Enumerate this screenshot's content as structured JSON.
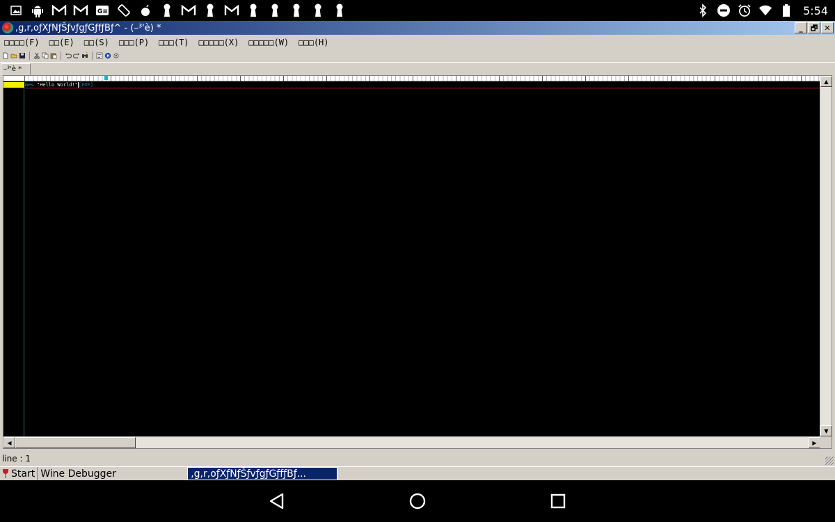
{
  "status_bar": {
    "notification_icons": [
      "image-icon",
      "android-icon",
      "gmail-icon",
      "gmail-icon",
      "news-icon",
      "rotate-icon",
      "bomb-icon",
      "keyhole-icon",
      "gmail-icon",
      "keyhole-icon",
      "gmail-icon",
      "keyhole-icon",
      "keyhole-icon",
      "keyhole-icon",
      "keyhole-icon",
      "keyhole-icon"
    ],
    "system_icons": [
      "bluetooth-icon",
      "do-not-disturb-icon",
      "alarm-icon",
      "wifi-icon",
      "battery-icon"
    ],
    "time": "5:54"
  },
  "window": {
    "title": ",g,r,oƒXƒNƒŠƒvƒgƒGƒfƒBƒ^ - (–³'è) *",
    "buttons": [
      "_",
      "🗗",
      "✕"
    ]
  },
  "menu": {
    "items": [
      "□□□□(F)",
      "□□(E)",
      "□□(S)",
      "□□□(P)",
      "□□□(T)",
      "□□□□□(X)",
      "□□□□□(W)",
      "□□□(H)"
    ]
  },
  "tab": {
    "label": "–³'è *"
  },
  "editor": {
    "keyword": "mes",
    "string": " \"Hello World!\"",
    "eof": "[EOF]"
  },
  "status": {
    "line": "line : 1"
  },
  "taskbar": {
    "start": "Start",
    "tasks": [
      "Wine Debugger",
      ",g,r,oƒXƒNƒŠƒvƒgƒGƒfƒBƒ..."
    ]
  },
  "colors": {
    "title_bar_start": "#0a246a",
    "title_bar_end": "#a6caf0",
    "editor_bg": "#000000",
    "gutter_current_line": "#f2f200",
    "keyword": "#1fa0a8",
    "line_marker": "#b21f3a"
  }
}
